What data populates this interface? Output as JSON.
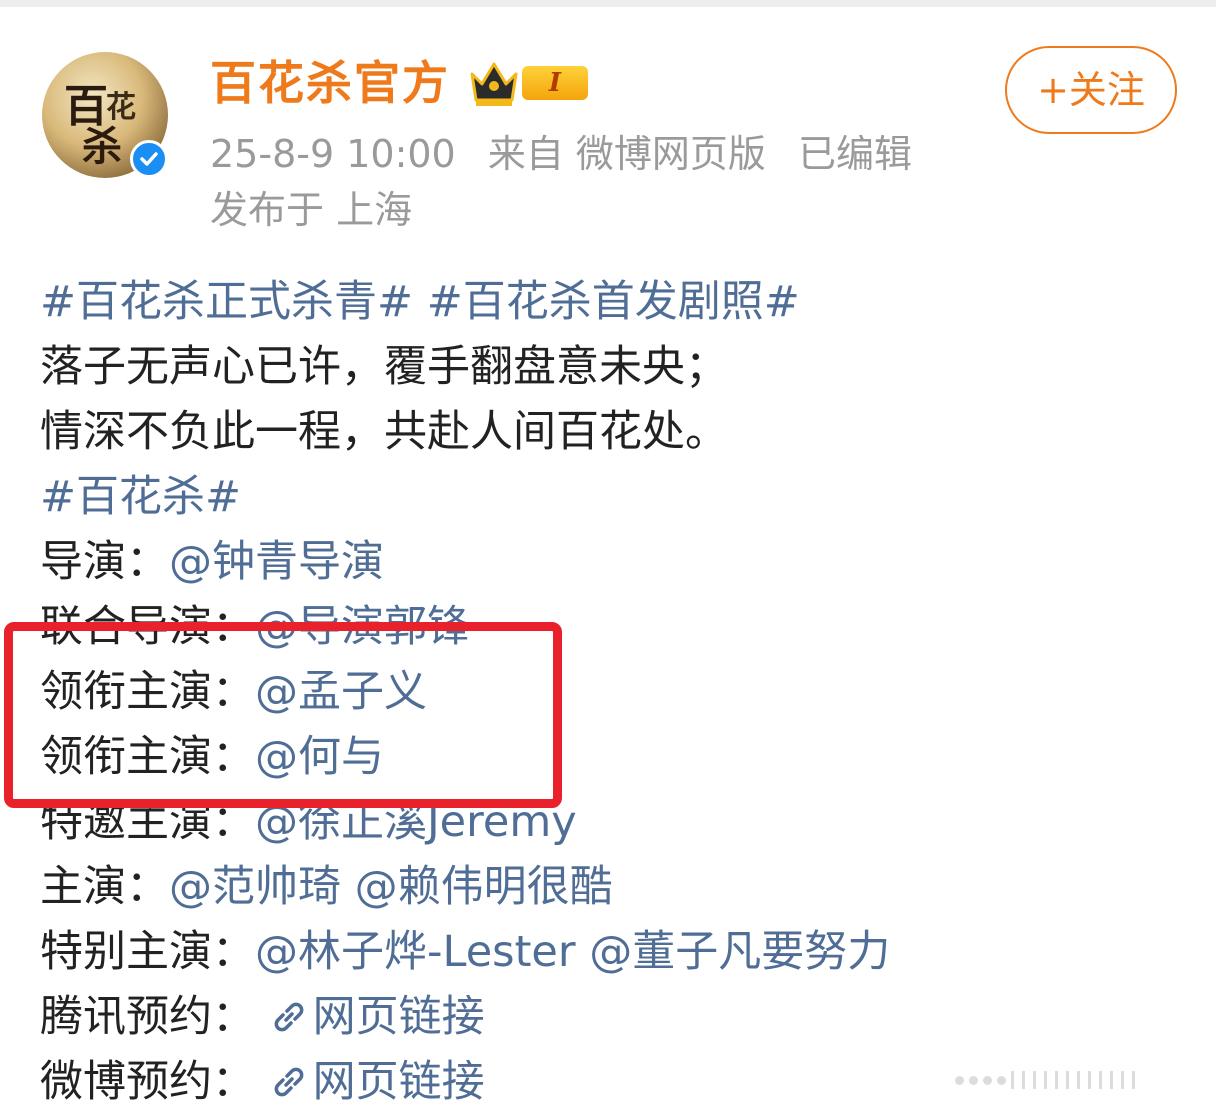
{
  "post": {
    "author": {
      "name": "百花杀官方",
      "vip_level": "I",
      "avatar_text": [
        "百",
        "花",
        "杀"
      ]
    },
    "follow_label": "+关注",
    "timestamp": "25-8-9 10:00",
    "source": "来自 微博网页版",
    "edited": "已编辑",
    "location": "发布于 上海",
    "content": {
      "hashtag_1": "#百花杀正式杀青#",
      "hashtag_2": "#百花杀首发剧照#",
      "poem_line_1": "落子无声心已许，覆手翻盘意未央；",
      "poem_line_2": "情深不负此一程，共赴人间百花处。",
      "hashtag_3": "#百花杀#",
      "director_label": "导演：",
      "director": "@钟青导演",
      "co_director_label": "联合导演：",
      "co_director": "@导演郭锋",
      "lead_label_1": "领衔主演：",
      "lead_1": "@孟子义",
      "lead_label_2": "领衔主演：",
      "lead_2": "@何与",
      "special_guest_label": "特邀主演：",
      "special_guest": "@徐正溪Jeremy",
      "cast_label": "主演：",
      "cast_1": "@范帅琦",
      "cast_2": "@赖伟明很酷",
      "special_cast_label": "特别主演：",
      "special_cast_1": "@林子烨-Lester",
      "special_cast_2": "@董子凡要努力",
      "tencent_label": "腾讯预约：",
      "tencent_link": "网页链接",
      "weibo_label": "微博预约：",
      "weibo_link": "网页链接"
    }
  },
  "colors": {
    "accent_orange": "#ee7a1b",
    "link_blue": "#4f6d95",
    "highlight_red": "#e8212b",
    "meta_gray": "#9a9a9a",
    "verified_blue": "#1a8ef2"
  }
}
